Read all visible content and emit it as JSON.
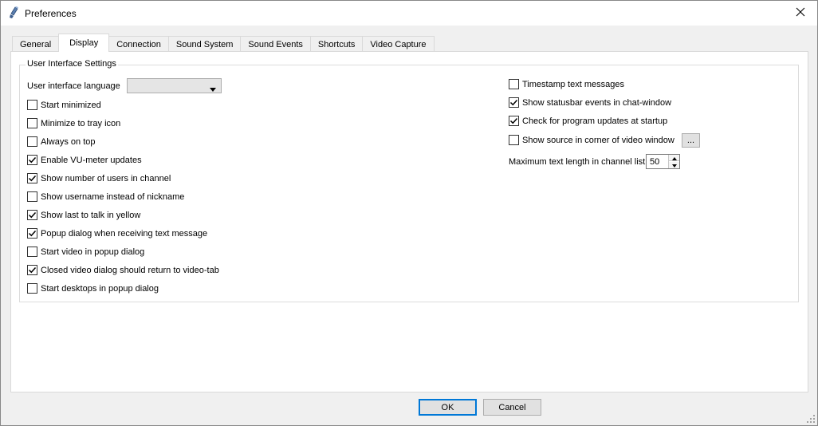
{
  "window": {
    "title": "Preferences",
    "close_glyph": "✕",
    "icon": "app-microphone-icon"
  },
  "tabs": [
    {
      "label": "General",
      "active": false
    },
    {
      "label": "Display",
      "active": true
    },
    {
      "label": "Connection",
      "active": false
    },
    {
      "label": "Sound System",
      "active": false
    },
    {
      "label": "Sound Events",
      "active": false
    },
    {
      "label": "Shortcuts",
      "active": false
    },
    {
      "label": "Video Capture",
      "active": false
    }
  ],
  "group": {
    "title": "User Interface Settings"
  },
  "language": {
    "label": "User interface language",
    "value": ""
  },
  "left_options": [
    {
      "label": "Start minimized",
      "checked": false
    },
    {
      "label": "Minimize to tray icon",
      "checked": false
    },
    {
      "label": "Always on top",
      "checked": false
    },
    {
      "label": "Enable VU-meter updates",
      "checked": true
    },
    {
      "label": "Show number of users in channel",
      "checked": true
    },
    {
      "label": "Show username instead of nickname",
      "checked": false
    },
    {
      "label": "Show last to talk in yellow",
      "checked": true
    },
    {
      "label": "Popup dialog when receiving text message",
      "checked": true
    },
    {
      "label": "Start video in popup dialog",
      "checked": false
    },
    {
      "label": "Closed video dialog should return to video-tab",
      "checked": true
    },
    {
      "label": "Start desktops in popup dialog",
      "checked": false
    }
  ],
  "right_options": [
    {
      "label": "Timestamp text messages",
      "checked": false
    },
    {
      "label": "Show statusbar events in chat-window",
      "checked": true
    },
    {
      "label": "Check for program updates at startup",
      "checked": true
    },
    {
      "label": "Show source in corner of video window",
      "checked": false
    }
  ],
  "source_browse": {
    "label": "..."
  },
  "max_text": {
    "label": "Maximum text length in channel list",
    "value": "50"
  },
  "buttons": {
    "ok": "OK",
    "cancel": "Cancel"
  },
  "colors": {
    "accent": "#0078d7",
    "panel": "#ffffff",
    "chrome": "#f0f0f0"
  }
}
